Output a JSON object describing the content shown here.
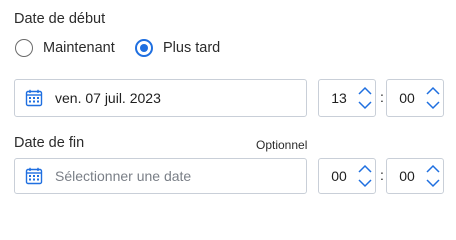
{
  "start": {
    "label": "Date de début",
    "options": [
      {
        "label": "Maintenant",
        "selected": false
      },
      {
        "label": "Plus tard",
        "selected": true
      }
    ],
    "date_value": "ven. 07 juil. 2023",
    "hour": "13",
    "minute": "00",
    "separator": ":"
  },
  "end": {
    "label": "Date de fin",
    "optional_label": "Optionnel",
    "date_placeholder": "Sélectionner une date",
    "hour": "00",
    "minute": "00",
    "separator": ":"
  },
  "colors": {
    "accent": "#1f6fe0",
    "border": "#c9cfd8",
    "placeholder": "#7a7f87"
  },
  "icons": {
    "calendar": "calendar-icon",
    "stepper": "chevron-up-down-icon"
  }
}
